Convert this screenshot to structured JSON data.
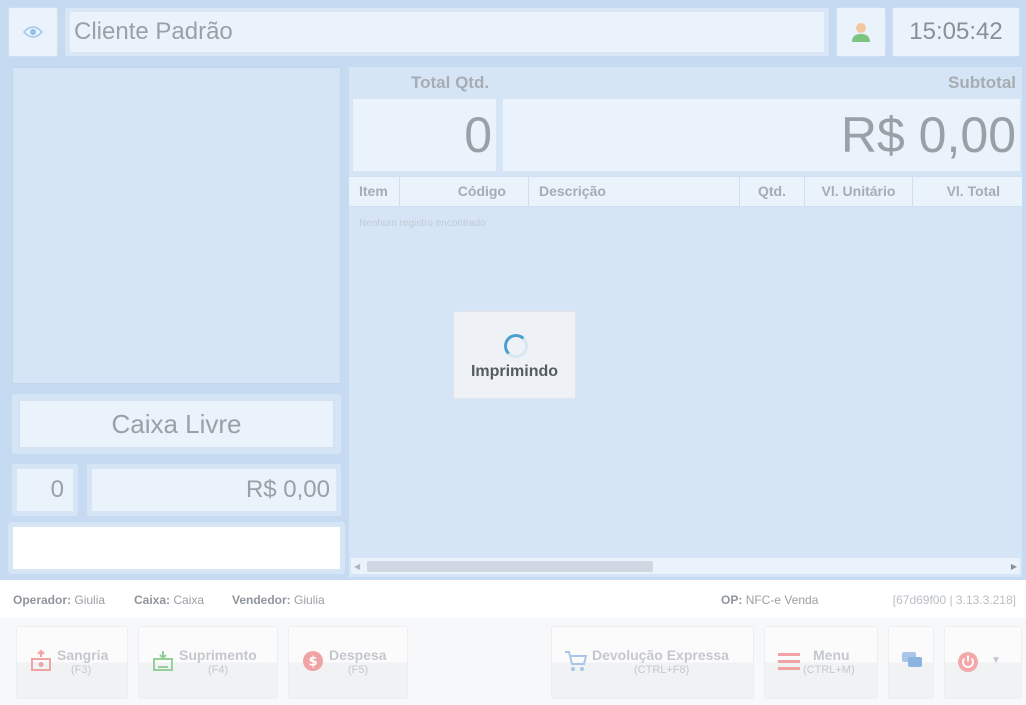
{
  "header": {
    "client_name": "Cliente Padrão",
    "clock": "15:05:42"
  },
  "left": {
    "status": "Caixa Livre",
    "item_count": "0",
    "total": "R$ 0,00"
  },
  "summary": {
    "total_qtd_label": "Total Qtd.",
    "subtotal_label": "Subtotal",
    "total_qtd_value": "0",
    "subtotal_value": "R$ 0,00"
  },
  "grid": {
    "columns": [
      "Item",
      "Código",
      "Descrição",
      "Qtd.",
      "Vl. Unitário",
      "Vl. Total"
    ],
    "empty_message": "Nenhum registro encontrado"
  },
  "loading": {
    "text": "Imprimindo"
  },
  "status_bar": {
    "operador_label": "Operador:",
    "operador_value": "Giulia",
    "caixa_label": "Caixa:",
    "caixa_value": "Caixa",
    "vendedor_label": "Vendedor:",
    "vendedor_value": "Giulia",
    "op_label": "OP:",
    "op_value": "NFC-e Venda",
    "version": "[67d69f00 | 3.13.3.218]"
  },
  "toolbar": {
    "sangria": {
      "label": "Sangria",
      "shortcut": "(F3)"
    },
    "suprimento": {
      "label": "Suprimento",
      "shortcut": "(F4)"
    },
    "despesa": {
      "label": "Despesa",
      "shortcut": "(F5)"
    },
    "devolucao": {
      "label": "Devolução Expressa",
      "shortcut": "(CTRL+F8)"
    },
    "menu": {
      "label": "Menu",
      "shortcut": "(CTRL+M)"
    }
  },
  "icons": {
    "eye": "eye-icon",
    "user": "user-icon",
    "sangria": "money-out-icon",
    "suprimento": "money-in-icon",
    "despesa": "coin-icon",
    "devolucao": "cart-icon",
    "menu": "hamburger-icon",
    "chat": "chat-icon",
    "power": "power-icon"
  },
  "colors": {
    "panel_bg": "#c6dbf2",
    "accent_red": "#e57373",
    "accent_green": "#4caf50",
    "accent_blue": "#4a90d9",
    "spinner": "#4a9fd0"
  }
}
